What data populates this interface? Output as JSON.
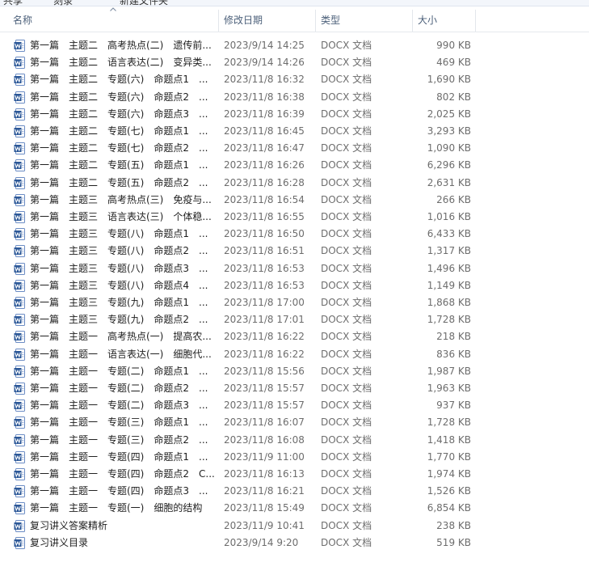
{
  "toolbar": {
    "fragments": [
      "共享",
      "刻录",
      "新建文件夹"
    ]
  },
  "columns": {
    "name": "名称",
    "date": "修改日期",
    "type": "类型",
    "size": "大小"
  },
  "colors": {
    "header_text": "#4c607a",
    "icon_blue": "#2b5797",
    "meta_text": "#6d6d6d"
  },
  "files": [
    {
      "name": "第一篇　主题二　高考热点(二)　遗传前...",
      "date": "2023/9/14 14:25",
      "type": "DOCX 文档",
      "size": "990 KB"
    },
    {
      "name": "第一篇　主题二　语言表达(二)　变异类...",
      "date": "2023/9/14 14:26",
      "type": "DOCX 文档",
      "size": "469 KB"
    },
    {
      "name": "第一篇　主题二　专题(六)　命题点1　...",
      "date": "2023/11/8 16:32",
      "type": "DOCX 文档",
      "size": "1,690 KB"
    },
    {
      "name": "第一篇　主题二　专题(六)　命题点2　...",
      "date": "2023/11/8 16:38",
      "type": "DOCX 文档",
      "size": "802 KB"
    },
    {
      "name": "第一篇　主题二　专题(六)　命题点3　...",
      "date": "2023/11/8 16:39",
      "type": "DOCX 文档",
      "size": "2,025 KB"
    },
    {
      "name": "第一篇　主题二　专题(七)　命题点1　...",
      "date": "2023/11/8 16:45",
      "type": "DOCX 文档",
      "size": "3,293 KB"
    },
    {
      "name": "第一篇　主题二　专题(七)　命题点2　...",
      "date": "2023/11/8 16:47",
      "type": "DOCX 文档",
      "size": "1,090 KB"
    },
    {
      "name": "第一篇　主题二　专题(五)　命题点1　...",
      "date": "2023/11/8 16:26",
      "type": "DOCX 文档",
      "size": "6,296 KB"
    },
    {
      "name": "第一篇　主题二　专题(五)　命题点2　...",
      "date": "2023/11/8 16:28",
      "type": "DOCX 文档",
      "size": "2,631 KB"
    },
    {
      "name": "第一篇　主题三　高考热点(三)　免疫与...",
      "date": "2023/11/8 16:54",
      "type": "DOCX 文档",
      "size": "266 KB"
    },
    {
      "name": "第一篇　主题三　语言表达(三)　个体稳...",
      "date": "2023/11/8 16:55",
      "type": "DOCX 文档",
      "size": "1,016 KB"
    },
    {
      "name": "第一篇　主题三　专题(八)　命题点1　...",
      "date": "2023/11/8 16:50",
      "type": "DOCX 文档",
      "size": "6,433 KB"
    },
    {
      "name": "第一篇　主题三　专题(八)　命题点2　...",
      "date": "2023/11/8 16:51",
      "type": "DOCX 文档",
      "size": "1,317 KB"
    },
    {
      "name": "第一篇　主题三　专题(八)　命题点3　...",
      "date": "2023/11/8 16:53",
      "type": "DOCX 文档",
      "size": "1,496 KB"
    },
    {
      "name": "第一篇　主题三　专题(八)　命题点4　...",
      "date": "2023/11/8 16:53",
      "type": "DOCX 文档",
      "size": "1,149 KB"
    },
    {
      "name": "第一篇　主题三　专题(九)　命题点1　...",
      "date": "2023/11/8 17:00",
      "type": "DOCX 文档",
      "size": "1,868 KB"
    },
    {
      "name": "第一篇　主题三　专题(九)　命题点2　...",
      "date": "2023/11/8 17:01",
      "type": "DOCX 文档",
      "size": "1,728 KB"
    },
    {
      "name": "第一篇　主题一　高考热点(一)　提高农...",
      "date": "2023/11/8 16:22",
      "type": "DOCX 文档",
      "size": "218 KB"
    },
    {
      "name": "第一篇　主题一　语言表达(一)　细胞代...",
      "date": "2023/11/8 16:22",
      "type": "DOCX 文档",
      "size": "836 KB"
    },
    {
      "name": "第一篇　主题一　专题(二)　命题点1　...",
      "date": "2023/11/8 15:56",
      "type": "DOCX 文档",
      "size": "1,987 KB"
    },
    {
      "name": "第一篇　主题一　专题(二)　命题点2　...",
      "date": "2023/11/8 15:57",
      "type": "DOCX 文档",
      "size": "1,963 KB"
    },
    {
      "name": "第一篇　主题一　专题(二)　命题点3　...",
      "date": "2023/11/8 15:57",
      "type": "DOCX 文档",
      "size": "937 KB"
    },
    {
      "name": "第一篇　主题一　专题(三)　命题点1　...",
      "date": "2023/11/8 16:07",
      "type": "DOCX 文档",
      "size": "1,728 KB"
    },
    {
      "name": "第一篇　主题一　专题(三)　命题点2　...",
      "date": "2023/11/8 16:08",
      "type": "DOCX 文档",
      "size": "1,418 KB"
    },
    {
      "name": "第一篇　主题一　专题(四)　命题点1　...",
      "date": "2023/11/9 11:00",
      "type": "DOCX 文档",
      "size": "1,770 KB"
    },
    {
      "name": "第一篇　主题一　专题(四)　命题点2　C...",
      "date": "2023/11/8 16:13",
      "type": "DOCX 文档",
      "size": "1,974 KB"
    },
    {
      "name": "第一篇　主题一　专题(四)　命题点3　...",
      "date": "2023/11/8 16:21",
      "type": "DOCX 文档",
      "size": "1,526 KB"
    },
    {
      "name": "第一篇　主题一　专题(一)　细胞的结构",
      "date": "2023/11/8 15:49",
      "type": "DOCX 文档",
      "size": "6,854 KB"
    },
    {
      "name": "复习讲义答案精析",
      "date": "2023/11/9 10:41",
      "type": "DOCX 文档",
      "size": "238 KB"
    },
    {
      "name": "复习讲义目录",
      "date": "2023/9/14 9:20",
      "type": "DOCX 文档",
      "size": "519 KB"
    }
  ]
}
